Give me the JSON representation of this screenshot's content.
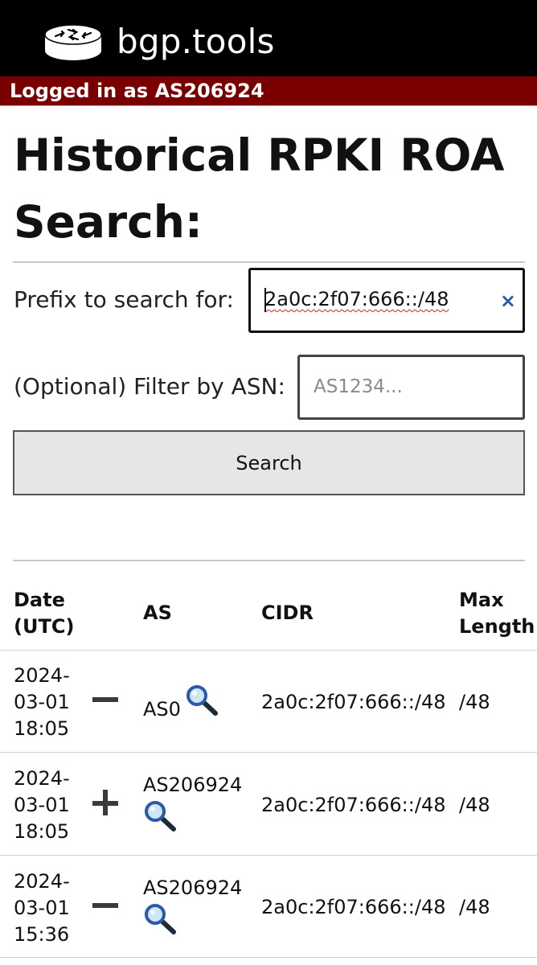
{
  "header": {
    "brand": "bgp.tools",
    "login_text": "Logged in as AS206924",
    "logo_icon": "router-icon"
  },
  "page": {
    "title": "Historical RPKI ROA Search:"
  },
  "form": {
    "prefix_label": "Prefix to search for:",
    "prefix_value": "2a0c:2f07:666::/48",
    "prefix_clear": "×",
    "asn_label": "(Optional) Filter by ASN:",
    "asn_placeholder": "AS1234...",
    "search_label": "Search"
  },
  "table": {
    "headers": {
      "date": [
        "Date",
        "(UTC)"
      ],
      "as": "AS",
      "cidr": "CIDR",
      "maxlen": [
        "Max",
        "Length"
      ]
    },
    "rows": [
      {
        "date": [
          "2024-",
          "03-01",
          "18:05"
        ],
        "action": "minus",
        "as": "AS0",
        "cidr": "2a0c:2f07:666::/48",
        "maxlen": "/48"
      },
      {
        "date": [
          "2024-",
          "03-01",
          "18:05"
        ],
        "action": "plus",
        "as": "AS206924",
        "cidr": "2a0c:2f07:666::/48",
        "maxlen": "/48"
      },
      {
        "date": [
          "2024-",
          "03-01",
          "15:36"
        ],
        "action": "minus",
        "as": "AS206924",
        "cidr": "2a0c:2f07:666::/48",
        "maxlen": "/48"
      }
    ]
  },
  "colors": {
    "topbar": "#000000",
    "loginbar": "#7a0000",
    "link_icon": "#2a5aa8"
  }
}
